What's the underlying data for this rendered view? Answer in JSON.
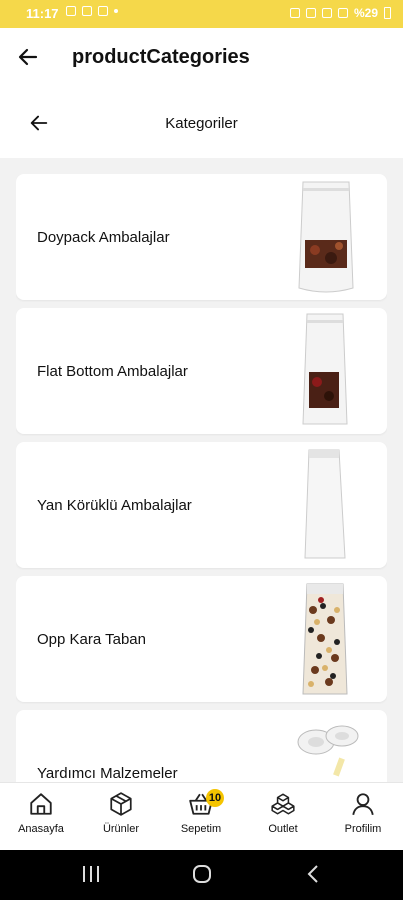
{
  "status_bar": {
    "time": "11:17",
    "battery": "%29"
  },
  "app_bar": {
    "title": "productCategories",
    "back_icon": "arrow-left-icon"
  },
  "sub_header": {
    "title": "Kategoriler",
    "back_icon": "arrow-left-icon"
  },
  "categories": [
    {
      "label": "Doypack Ambalajlar",
      "image": "white stand-up pouch with window"
    },
    {
      "label": "Flat Bottom Ambalajlar",
      "image": "white flat bottom bag with window"
    },
    {
      "label": "Yan Körüklü Ambalajlar",
      "image": "white side gusset bag"
    },
    {
      "label": "Opp Kara Taban",
      "image": "clear bag filled with mixed nuts"
    },
    {
      "label": "Yardımcı Malzemeler",
      "image": "valve accessories"
    }
  ],
  "bottom_nav": [
    {
      "label": "Anasayfa",
      "icon": "home-icon"
    },
    {
      "label": "Ürünler",
      "icon": "box-icon"
    },
    {
      "label": "Sepetim",
      "icon": "basket-icon",
      "badge": "10"
    },
    {
      "label": "Outlet",
      "icon": "boxes-icon"
    },
    {
      "label": "Profilim",
      "icon": "user-icon"
    }
  ],
  "colors": {
    "status_bar": "#f5d84a",
    "badge": "#f5c400",
    "background": "#f2f2f2"
  }
}
